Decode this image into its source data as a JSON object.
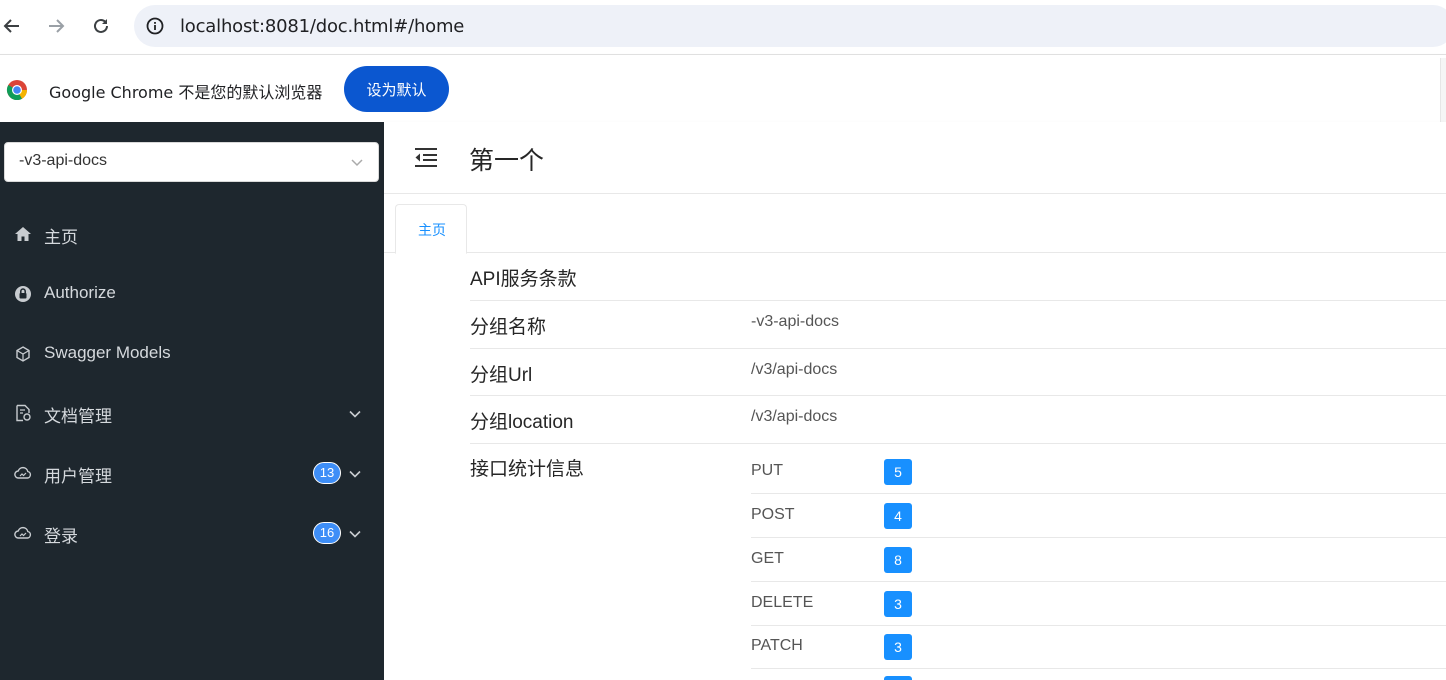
{
  "browser": {
    "url": "localhost:8081/doc.html#/home",
    "infobar_text": "Google Chrome 不是您的默认浏览器",
    "infobar_button": "设为默认"
  },
  "sidebar": {
    "group_select": "-v3-api-docs",
    "items": [
      {
        "label": "主页",
        "icon": "home-icon"
      },
      {
        "label": "Authorize",
        "icon": "lock-icon"
      },
      {
        "label": "Swagger Models",
        "icon": "cube-icon"
      },
      {
        "label": "文档管理",
        "icon": "doc-settings-icon"
      },
      {
        "label": "用户管理",
        "icon": "cloud-icon",
        "badge": "13"
      },
      {
        "label": "登录",
        "icon": "cloud-icon",
        "badge": "16"
      }
    ]
  },
  "main": {
    "title": "第一个",
    "tab": "主页",
    "rows": [
      {
        "key": "API服务条款",
        "value": ""
      },
      {
        "key": "分组名称",
        "value": "-v3-api-docs"
      },
      {
        "key": "分组Url",
        "value": "/v3/api-docs"
      },
      {
        "key": "分组location",
        "value": "/v3/api-docs"
      }
    ],
    "stats_label": "接口统计信息",
    "stats": [
      {
        "method": "PUT",
        "count": "5"
      },
      {
        "method": "POST",
        "count": "4"
      },
      {
        "method": "GET",
        "count": "8"
      },
      {
        "method": "DELETE",
        "count": "3"
      },
      {
        "method": "PATCH",
        "count": "3"
      }
    ]
  },
  "colors": {
    "sidebar_bg": "#1e272e",
    "accent": "#1890ff",
    "chrome_button": "#0b57d0",
    "badge": "#3e8ef7"
  }
}
